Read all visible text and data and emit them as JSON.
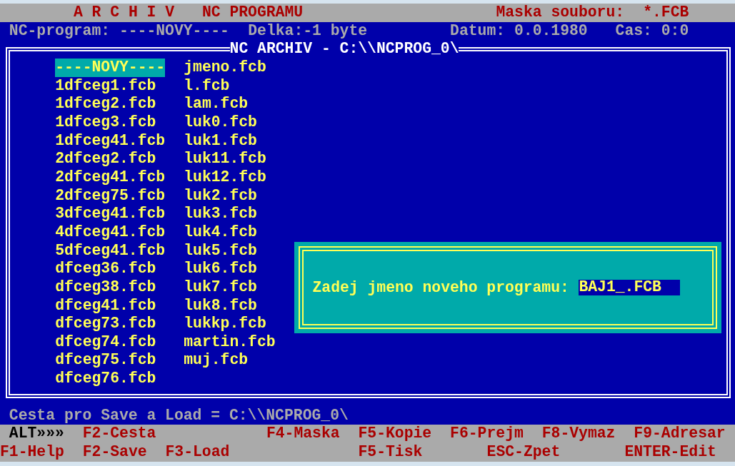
{
  "header": {
    "title": "A R C H I V",
    "subtitle": "NC PROGRAMU",
    "mask_label": "Maska souboru:",
    "mask_value": "*.FCB"
  },
  "info_bar": {
    "program": "NC-program: ----NOVY----",
    "length": "Delka:-1 byte",
    "date": "Datum: 0.0.1980",
    "time": "Cas: 0:0"
  },
  "panel": {
    "title": "NC ARCHIV - C:\\\\NCPROG_0\\",
    "files": [
      {
        "name": "----NOVY----",
        "selected": true
      },
      {
        "name": "1dfceg1.fcb",
        "selected": false
      },
      {
        "name": "1dfceg2.fcb",
        "selected": false
      },
      {
        "name": "1dfceg3.fcb",
        "selected": false
      },
      {
        "name": "1dfceg41.fcb",
        "selected": false
      },
      {
        "name": "2dfceg2.fcb",
        "selected": false
      },
      {
        "name": "2dfceg41.fcb",
        "selected": false
      },
      {
        "name": "2dfceg75.fcb",
        "selected": false
      },
      {
        "name": "3dfceg41.fcb",
        "selected": false
      },
      {
        "name": "4dfceg41.fcb",
        "selected": false
      },
      {
        "name": "5dfceg41.fcb",
        "selected": false
      },
      {
        "name": "dfceg36.fcb",
        "selected": false
      },
      {
        "name": "dfceg38.fcb",
        "selected": false
      },
      {
        "name": "dfceg41.fcb",
        "selected": false
      },
      {
        "name": "dfceg73.fcb",
        "selected": false
      },
      {
        "name": "dfceg74.fcb",
        "selected": false
      },
      {
        "name": "dfceg75.fcb",
        "selected": false
      },
      {
        "name": "dfceg76.fcb",
        "selected": false
      },
      {
        "name": "jmeno.fcb",
        "selected": false
      },
      {
        "name": "l.fcb",
        "selected": false
      },
      {
        "name": "lam.fcb",
        "selected": false
      },
      {
        "name": "luk0.fcb",
        "selected": false
      },
      {
        "name": "luk1.fcb",
        "selected": false
      },
      {
        "name": "luk11.fcb",
        "selected": false
      },
      {
        "name": "luk12.fcb",
        "selected": false
      },
      {
        "name": "luk2.fcb",
        "selected": false
      },
      {
        "name": "luk3.fcb",
        "selected": false
      },
      {
        "name": "luk4.fcb",
        "selected": false
      },
      {
        "name": "luk5.fcb",
        "selected": false
      },
      {
        "name": "luk6.fcb",
        "selected": false
      },
      {
        "name": "luk7.fcb",
        "selected": false
      },
      {
        "name": "luk8.fcb",
        "selected": false
      },
      {
        "name": "lukkp.fcb",
        "selected": false
      },
      {
        "name": "martin.fcb",
        "selected": false
      },
      {
        "name": "muj.fcb",
        "selected": false
      }
    ]
  },
  "dialog": {
    "prompt": "Zadej jmeno noveho programu:",
    "value": "BAJ1_.FCB"
  },
  "status_bar": "Cesta pro Save a Load = C:\\\\NCPROG_0\\",
  "function_keys": [
    [
      {
        "label": "ALT»»»",
        "kind": "modifier"
      },
      {
        "label": "F2-Cesta",
        "kind": "key"
      },
      {
        "label": "F4-Maska",
        "kind": "key"
      },
      {
        "label": "F5-Kopie",
        "kind": "key"
      },
      {
        "label": "F6-Prejm",
        "kind": "key"
      },
      {
        "label": "F8-Vymaz",
        "kind": "key"
      },
      {
        "label": "F9-Adresar",
        "kind": "key"
      }
    ],
    [
      {
        "label": "F1-Help",
        "kind": "key"
      },
      {
        "label": "F2-Save",
        "kind": "key"
      },
      {
        "label": "F3-Load",
        "kind": "key"
      },
      {
        "label": "F5-Tisk",
        "kind": "key"
      },
      {
        "label": "ESC-Zpet",
        "kind": "key"
      },
      {
        "label": "ENTER-Edit",
        "kind": "key"
      }
    ]
  ]
}
